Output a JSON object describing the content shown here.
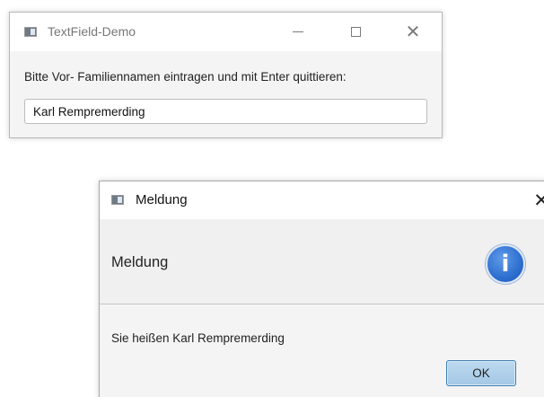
{
  "main_window": {
    "title": "TextField-Demo",
    "instruction": "Bitte Vor- Familiennamen eintragen und mit Enter quittieren:",
    "name_field_value": "Karl Rempremerding",
    "controls": {
      "minimize": "minimize-icon",
      "maximize": "maximize-icon",
      "close": "✕"
    }
  },
  "dialog": {
    "title": "Meldung",
    "header": "Meldung",
    "info_icon_glyph": "i",
    "message": "Sie heißen Karl Rempremerding",
    "ok_label": "OK",
    "close": "✕"
  },
  "colors": {
    "info_blue": "#2e6fd0",
    "ok_button": "#a4c8e6"
  }
}
